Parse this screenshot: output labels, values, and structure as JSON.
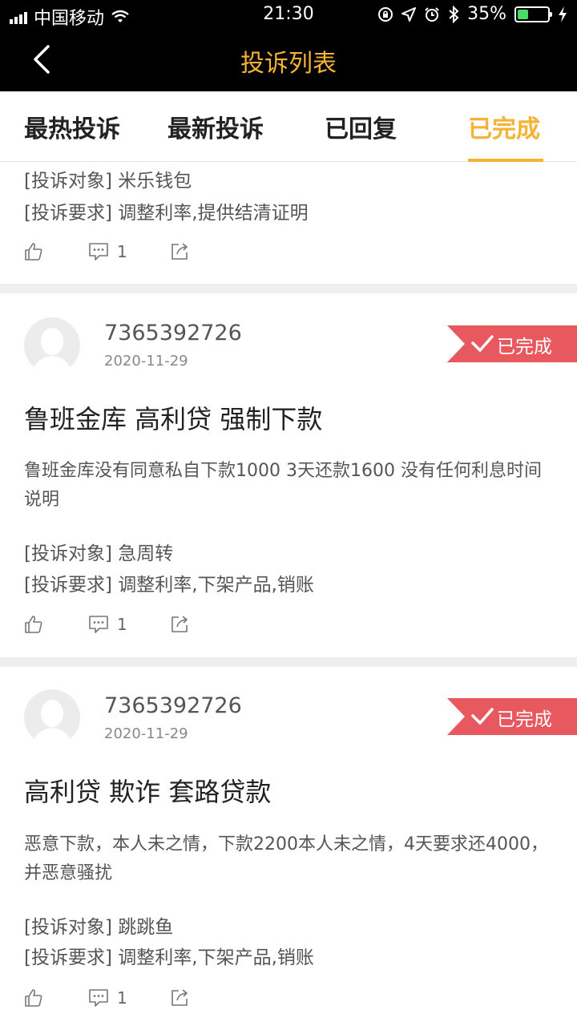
{
  "status_bar": {
    "carrier": "中国移动",
    "time": "21:30",
    "battery_percent": "35%",
    "battery_level": 0.35
  },
  "nav": {
    "title": "投诉列表"
  },
  "tabs": [
    {
      "label": "最热投诉",
      "active": false
    },
    {
      "label": "最新投诉",
      "active": false
    },
    {
      "label": "已回复",
      "active": false
    },
    {
      "label": "已完成",
      "active": true
    }
  ],
  "partial_card": {
    "target_line": "[投诉对象] 米乐钱包",
    "request_line": "[投诉要求] 调整利率,提供结清证明",
    "comment_count": "1"
  },
  "cards": [
    {
      "user_id": "7365392726",
      "date": "2020-11-29",
      "status": "已完成",
      "title": "鲁班金库 高利贷 强制下款",
      "body": "鲁班金库没有同意私自下款1000 3天还款1600 没有任何利息时间说明",
      "target_line": "[投诉对象]  急周转",
      "request_line": "[投诉要求] 调整利率,下架产品,销账",
      "comment_count": "1"
    },
    {
      "user_id": "7365392726",
      "date": "2020-11-29",
      "status": "已完成",
      "title": "高利贷 欺诈 套路贷款",
      "body": "恶意下款，本人未之情，下款2200本人未之情，4天要求还4000，并恶意骚扰",
      "target_line": "[投诉对象] 跳跳鱼",
      "request_line": "[投诉要求] 调整利率,下架产品,销账",
      "comment_count": "1"
    }
  ],
  "colors": {
    "accent": "#f5b335",
    "status_badge": "#e8595f",
    "nav_bg": "#000000"
  },
  "icons": [
    "signal-icon",
    "wifi-icon",
    "lock-rotation-icon",
    "location-icon",
    "alarm-icon",
    "bluetooth-icon",
    "battery-icon",
    "charging-icon",
    "back-icon",
    "like-icon",
    "comment-icon",
    "share-icon",
    "avatar-icon",
    "check-icon"
  ]
}
